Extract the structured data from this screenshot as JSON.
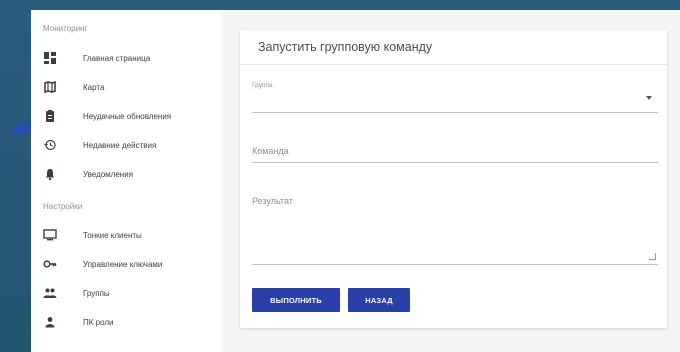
{
  "sidebar": {
    "sections": [
      {
        "title": "Мониторинг",
        "items": [
          {
            "label": "Главная страница",
            "icon": "dashboard-icon"
          },
          {
            "label": "Карта",
            "icon": "map-icon"
          },
          {
            "label": "Неудачные обновления",
            "icon": "clipboard-icon"
          },
          {
            "label": "Недавние действия",
            "icon": "history-icon"
          },
          {
            "label": "Уведомления",
            "icon": "bell-icon"
          }
        ]
      },
      {
        "title": "Настройки",
        "items": [
          {
            "label": "Тонкие клиенты",
            "icon": "monitor-icon"
          },
          {
            "label": "Управление ключами",
            "icon": "key-icon"
          },
          {
            "label": "Группы",
            "icon": "people-icon"
          },
          {
            "label": "ПК роли",
            "icon": "person-icon"
          }
        ]
      }
    ]
  },
  "form": {
    "title": "Запустить групповую команду",
    "group_label": "Группа",
    "command_label": "Команда",
    "result_label": "Результат",
    "execute_button": "ВЫПОЛНИТЬ",
    "back_button": "НАЗАД"
  },
  "colors": {
    "accent": "#2a3fa8",
    "background_frame": "#2a5c7e",
    "sidebar_bg": "#ffffff"
  }
}
